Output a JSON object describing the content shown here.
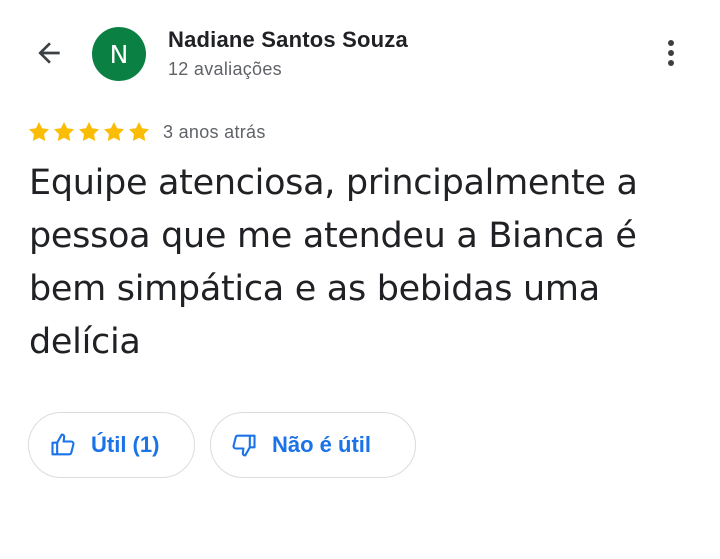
{
  "header": {
    "back_icon": "arrow-back-icon",
    "more_icon": "more-vert-icon"
  },
  "reviewer": {
    "avatar_letter": "N",
    "avatar_color": "#0b8043",
    "name": "Nadiane Santos Souza",
    "review_count": "12 avaliações"
  },
  "review": {
    "rating": 5,
    "rating_max": 5,
    "star_color": "#fbbc04",
    "date": "3 anos atrás",
    "text": "Equipe atenciosa, principalmente a pessoa que me atendeu a Bianca é bem simpática e as bebidas uma delícia"
  },
  "actions": {
    "useful_icon": "thumb-up-icon",
    "useful_label": "Útil (1)",
    "not_useful_icon": "thumb-down-icon",
    "not_useful_label": "Não é útil",
    "accent_color": "#1a73e8"
  }
}
